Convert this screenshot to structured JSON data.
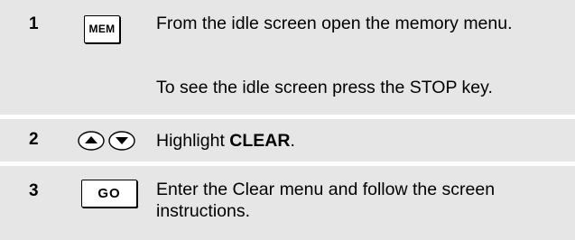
{
  "steps": [
    {
      "number": "1",
      "key_label": "MEM",
      "key_icon": "mem-key-icon",
      "lines": [
        "From the idle screen open the memory menu.",
        "To see the idle screen press the STOP key."
      ]
    },
    {
      "number": "2",
      "key_icon": "up-down-arrow-keys-icon",
      "text_bold": "CLEAR",
      "text_before": "Highlight ",
      "text_after": "."
    },
    {
      "number": "3",
      "key_label": "GO",
      "key_icon": "go-key-icon",
      "lines": [
        "Enter the Clear menu and follow the screen instructions."
      ]
    }
  ],
  "colors": {
    "row_shade": "#e6e6e6",
    "text": "#000000"
  }
}
